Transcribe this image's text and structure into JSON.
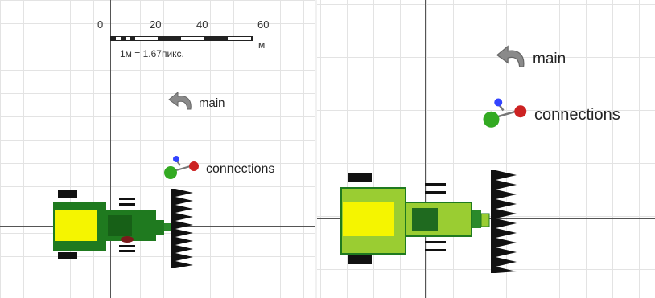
{
  "scale_bar": {
    "ticks": [
      "0",
      "20",
      "40",
      "60"
    ],
    "unit": "м",
    "caption": "1м = 1.67пикс."
  },
  "links": {
    "main_label": "main",
    "connections_label": "connections"
  },
  "icons": {
    "main": "curved-arrow-icon",
    "connections": "connections-molecule-icon"
  },
  "colors": {
    "tractor_dark": "#1f7a1f",
    "tractor_light": "#9acd32",
    "cabin": "#f5f500",
    "harrow": "#111111",
    "axis": "#555555",
    "grid": "#e3e3e3"
  }
}
